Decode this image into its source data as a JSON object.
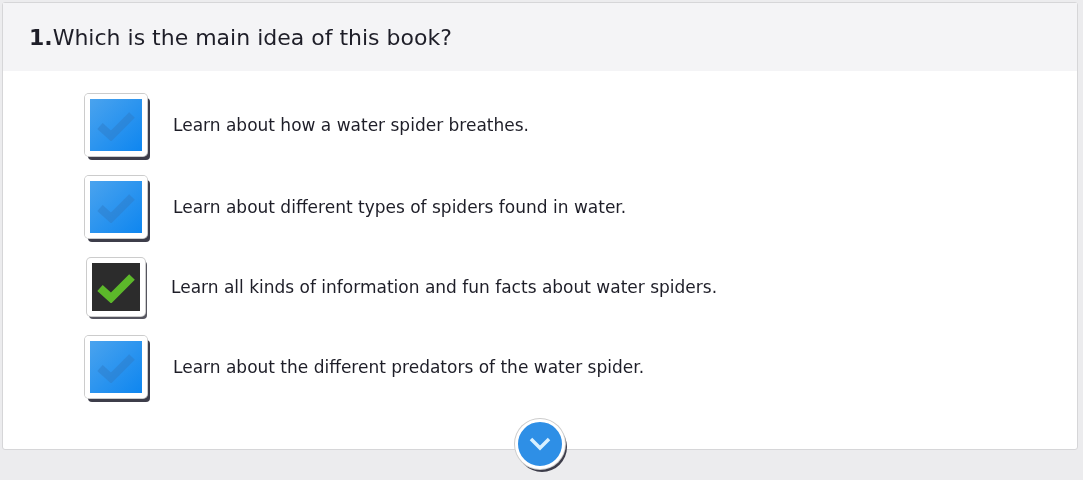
{
  "question": {
    "number": "1.",
    "text": "Which is the main idea of this book?"
  },
  "options": [
    {
      "label": "Learn about how a water spider breathes.",
      "selected": false
    },
    {
      "label": "Learn about different types of spiders found in water.",
      "selected": false
    },
    {
      "label": "Learn all kinds of information and fun facts about water spiders.",
      "selected": true
    },
    {
      "label": "Learn about the different predators of the water spider.",
      "selected": false
    }
  ]
}
